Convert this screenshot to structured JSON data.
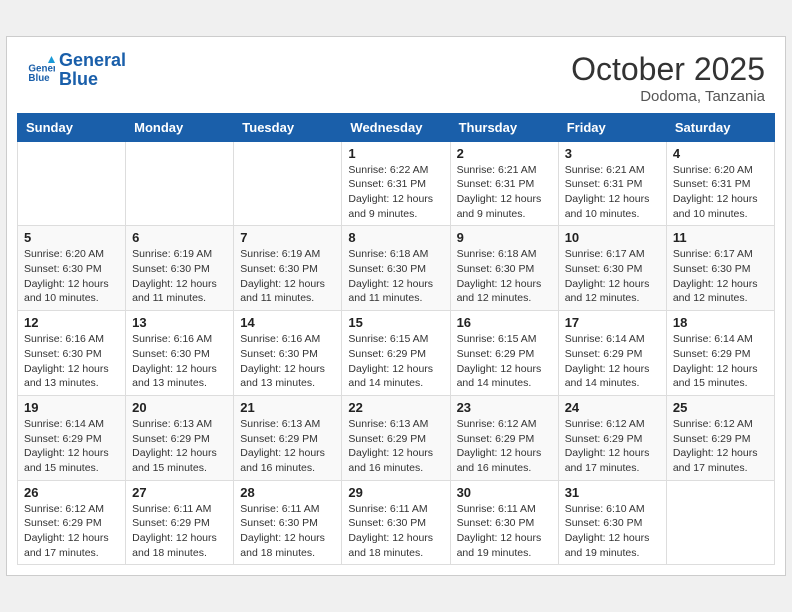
{
  "header": {
    "logo_line1": "General",
    "logo_line2": "Blue",
    "month": "October 2025",
    "location": "Dodoma, Tanzania"
  },
  "days_of_week": [
    "Sunday",
    "Monday",
    "Tuesday",
    "Wednesday",
    "Thursday",
    "Friday",
    "Saturday"
  ],
  "weeks": [
    [
      {
        "day": "",
        "info": ""
      },
      {
        "day": "",
        "info": ""
      },
      {
        "day": "",
        "info": ""
      },
      {
        "day": "1",
        "info": "Sunrise: 6:22 AM\nSunset: 6:31 PM\nDaylight: 12 hours and 9 minutes."
      },
      {
        "day": "2",
        "info": "Sunrise: 6:21 AM\nSunset: 6:31 PM\nDaylight: 12 hours and 9 minutes."
      },
      {
        "day": "3",
        "info": "Sunrise: 6:21 AM\nSunset: 6:31 PM\nDaylight: 12 hours and 10 minutes."
      },
      {
        "day": "4",
        "info": "Sunrise: 6:20 AM\nSunset: 6:31 PM\nDaylight: 12 hours and 10 minutes."
      }
    ],
    [
      {
        "day": "5",
        "info": "Sunrise: 6:20 AM\nSunset: 6:30 PM\nDaylight: 12 hours and 10 minutes."
      },
      {
        "day": "6",
        "info": "Sunrise: 6:19 AM\nSunset: 6:30 PM\nDaylight: 12 hours and 11 minutes."
      },
      {
        "day": "7",
        "info": "Sunrise: 6:19 AM\nSunset: 6:30 PM\nDaylight: 12 hours and 11 minutes."
      },
      {
        "day": "8",
        "info": "Sunrise: 6:18 AM\nSunset: 6:30 PM\nDaylight: 12 hours and 11 minutes."
      },
      {
        "day": "9",
        "info": "Sunrise: 6:18 AM\nSunset: 6:30 PM\nDaylight: 12 hours and 12 minutes."
      },
      {
        "day": "10",
        "info": "Sunrise: 6:17 AM\nSunset: 6:30 PM\nDaylight: 12 hours and 12 minutes."
      },
      {
        "day": "11",
        "info": "Sunrise: 6:17 AM\nSunset: 6:30 PM\nDaylight: 12 hours and 12 minutes."
      }
    ],
    [
      {
        "day": "12",
        "info": "Sunrise: 6:16 AM\nSunset: 6:30 PM\nDaylight: 12 hours and 13 minutes."
      },
      {
        "day": "13",
        "info": "Sunrise: 6:16 AM\nSunset: 6:30 PM\nDaylight: 12 hours and 13 minutes."
      },
      {
        "day": "14",
        "info": "Sunrise: 6:16 AM\nSunset: 6:30 PM\nDaylight: 12 hours and 13 minutes."
      },
      {
        "day": "15",
        "info": "Sunrise: 6:15 AM\nSunset: 6:29 PM\nDaylight: 12 hours and 14 minutes."
      },
      {
        "day": "16",
        "info": "Sunrise: 6:15 AM\nSunset: 6:29 PM\nDaylight: 12 hours and 14 minutes."
      },
      {
        "day": "17",
        "info": "Sunrise: 6:14 AM\nSunset: 6:29 PM\nDaylight: 12 hours and 14 minutes."
      },
      {
        "day": "18",
        "info": "Sunrise: 6:14 AM\nSunset: 6:29 PM\nDaylight: 12 hours and 15 minutes."
      }
    ],
    [
      {
        "day": "19",
        "info": "Sunrise: 6:14 AM\nSunset: 6:29 PM\nDaylight: 12 hours and 15 minutes."
      },
      {
        "day": "20",
        "info": "Sunrise: 6:13 AM\nSunset: 6:29 PM\nDaylight: 12 hours and 15 minutes."
      },
      {
        "day": "21",
        "info": "Sunrise: 6:13 AM\nSunset: 6:29 PM\nDaylight: 12 hours and 16 minutes."
      },
      {
        "day": "22",
        "info": "Sunrise: 6:13 AM\nSunset: 6:29 PM\nDaylight: 12 hours and 16 minutes."
      },
      {
        "day": "23",
        "info": "Sunrise: 6:12 AM\nSunset: 6:29 PM\nDaylight: 12 hours and 16 minutes."
      },
      {
        "day": "24",
        "info": "Sunrise: 6:12 AM\nSunset: 6:29 PM\nDaylight: 12 hours and 17 minutes."
      },
      {
        "day": "25",
        "info": "Sunrise: 6:12 AM\nSunset: 6:29 PM\nDaylight: 12 hours and 17 minutes."
      }
    ],
    [
      {
        "day": "26",
        "info": "Sunrise: 6:12 AM\nSunset: 6:29 PM\nDaylight: 12 hours and 17 minutes."
      },
      {
        "day": "27",
        "info": "Sunrise: 6:11 AM\nSunset: 6:29 PM\nDaylight: 12 hours and 18 minutes."
      },
      {
        "day": "28",
        "info": "Sunrise: 6:11 AM\nSunset: 6:30 PM\nDaylight: 12 hours and 18 minutes."
      },
      {
        "day": "29",
        "info": "Sunrise: 6:11 AM\nSunset: 6:30 PM\nDaylight: 12 hours and 18 minutes."
      },
      {
        "day": "30",
        "info": "Sunrise: 6:11 AM\nSunset: 6:30 PM\nDaylight: 12 hours and 19 minutes."
      },
      {
        "day": "31",
        "info": "Sunrise: 6:10 AM\nSunset: 6:30 PM\nDaylight: 12 hours and 19 minutes."
      },
      {
        "day": "",
        "info": ""
      }
    ]
  ]
}
